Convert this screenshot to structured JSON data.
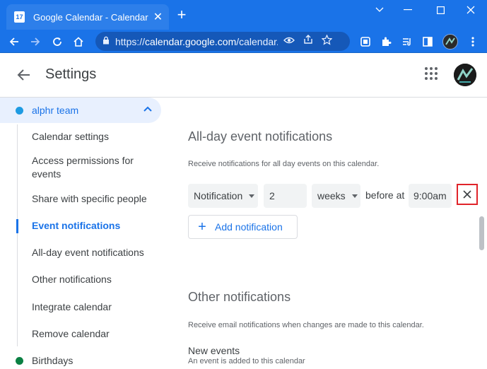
{
  "browser": {
    "tab_favicon": "17",
    "tab_title": "Google Calendar - Calendar setting",
    "url_domain": "calendar.google.com",
    "url_rest": "/calendar...",
    "url_prefix": "https://"
  },
  "header": {
    "title": "Settings"
  },
  "sidebar": {
    "calendar": {
      "name": "alphr team",
      "color": "#1e9be2"
    },
    "items": [
      {
        "label": "Calendar settings"
      },
      {
        "label": "Access permissions for events"
      },
      {
        "label": "Share with specific people"
      },
      {
        "label": "Event notifications",
        "active": true
      },
      {
        "label": "All-day event notifications"
      },
      {
        "label": "Other notifications"
      },
      {
        "label": "Integrate calendar"
      },
      {
        "label": "Remove calendar"
      }
    ],
    "birthdays": {
      "name": "Birthdays",
      "color": "#0b8043"
    }
  },
  "main": {
    "allday": {
      "title": "All-day event notifications",
      "description": "Receive notifications for all day events on this calendar.",
      "notification": {
        "type": "Notification",
        "amount": "2",
        "unit": "weeks",
        "before_at": "before at",
        "time": "9:00am"
      },
      "add_label": "Add notification"
    },
    "other": {
      "title": "Other notifications",
      "description": "Receive email notifications when changes are made to this calendar.",
      "new_events_title": "New events",
      "new_events_desc": "An event is added to this calendar"
    }
  },
  "colors": {
    "accent": "#1a73e8",
    "highlight_box": "#e0242a"
  }
}
